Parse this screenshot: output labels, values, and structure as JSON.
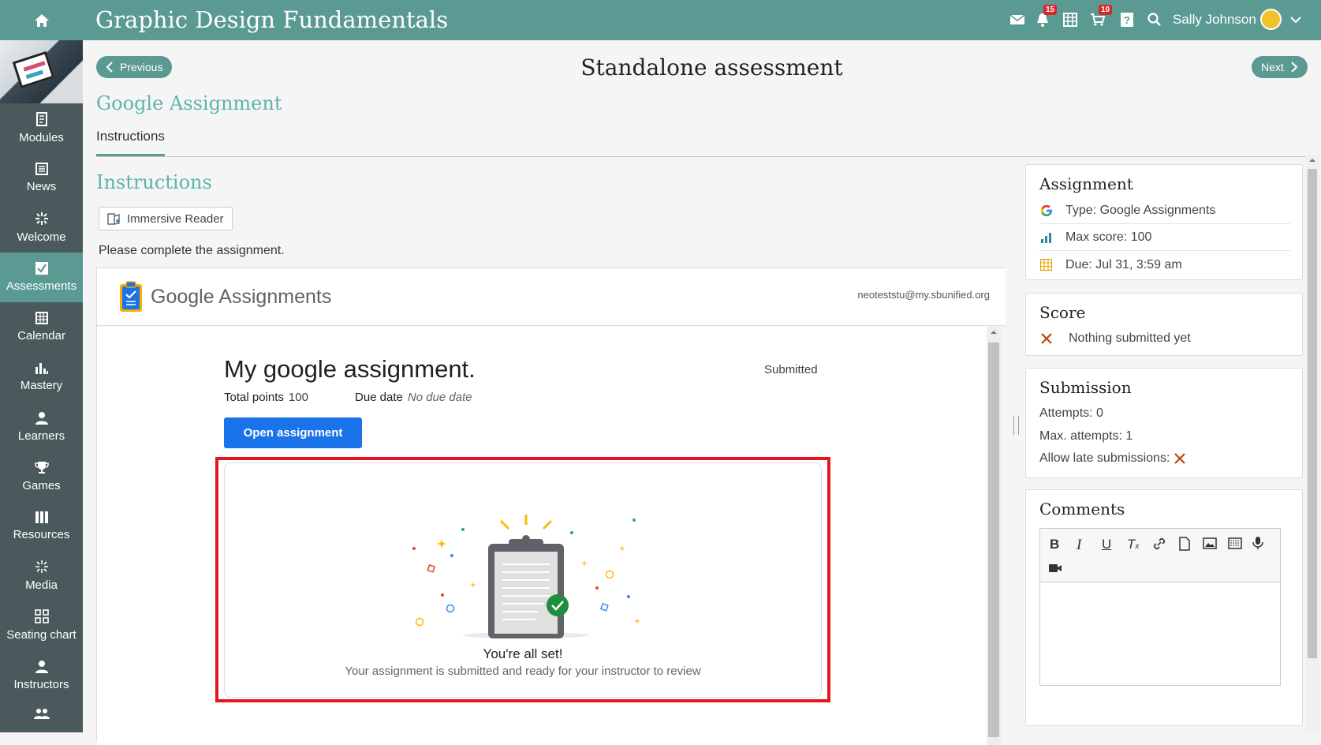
{
  "topbar": {
    "course_title": "Graphic Design Fundamentals",
    "notifications_count": "15",
    "cart_count": "10",
    "user_name": "Sally Johnson",
    "accent_color": "#5a9a93"
  },
  "sidebar": {
    "items": [
      {
        "label": "Modules",
        "icon": "book-icon"
      },
      {
        "label": "News",
        "icon": "newspaper-icon"
      },
      {
        "label": "Welcome",
        "icon": "sparkle-icon"
      },
      {
        "label": "Assessments",
        "icon": "checkbox-icon",
        "active": true
      },
      {
        "label": "Calendar",
        "icon": "calendar-icon"
      },
      {
        "label": "Mastery",
        "icon": "bar-chart-icon"
      },
      {
        "label": "Learners",
        "icon": "person-icon"
      },
      {
        "label": "Games",
        "icon": "trophy-icon"
      },
      {
        "label": "Resources",
        "icon": "books-icon"
      },
      {
        "label": "Media",
        "icon": "media-icon"
      },
      {
        "label": "Seating chart",
        "icon": "seating-icon"
      },
      {
        "label": "Instructors",
        "icon": "instructor-icon"
      }
    ]
  },
  "nav": {
    "previous_label": "Previous",
    "next_label": "Next",
    "page_title": "Standalone assessment"
  },
  "assignment": {
    "title": "Google Assignment",
    "tab_label": "Instructions",
    "instructions_heading": "Instructions",
    "immersive_reader_label": "Immersive Reader",
    "instructions_text": "Please complete the assignment."
  },
  "google": {
    "brand_google": "Google",
    "brand_assignments": "Assignments",
    "email": "neoteststu@my.sbunified.org",
    "assignment_title": "My google assignment.",
    "status": "Submitted",
    "total_points_label": "Total points",
    "total_points_value": "100",
    "due_date_label": "Due date",
    "due_date_value": "No due date",
    "open_button": "Open assignment",
    "done_title": "You're all set!",
    "done_subtitle": "Your assignment is submitted and ready for your instructor to review"
  },
  "right_panel": {
    "assignment_heading": "Assignment",
    "type": "Type: Google Assignments",
    "max_score": "Max score: 100",
    "due": "Due: Jul 31, 3:59 am",
    "score_heading": "Score",
    "score_status": "Nothing submitted yet",
    "submission_heading": "Submission",
    "attempts": "Attempts: 0",
    "max_attempts": "Max. attempts: 1",
    "late_submissions": "Allow late submissions:",
    "comments_heading": "Comments"
  }
}
